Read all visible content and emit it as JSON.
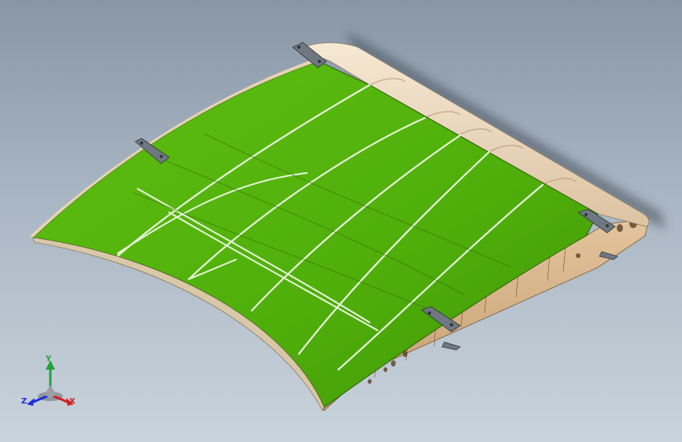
{
  "viewport": {
    "background_top": "#8896a6",
    "background_bottom": "#c9d3dc"
  },
  "model": {
    "skin_color": "#4fae0a",
    "leading_edge_color": "#efdcc2",
    "rib_color": "#d8b48a",
    "bracket_color": "#6f7880"
  },
  "triad": {
    "y_label": "Y",
    "x_label": "X",
    "z_label": "Z",
    "y_color": "#22a33a",
    "x_color": "#d42020",
    "z_color": "#1c2fd6"
  }
}
